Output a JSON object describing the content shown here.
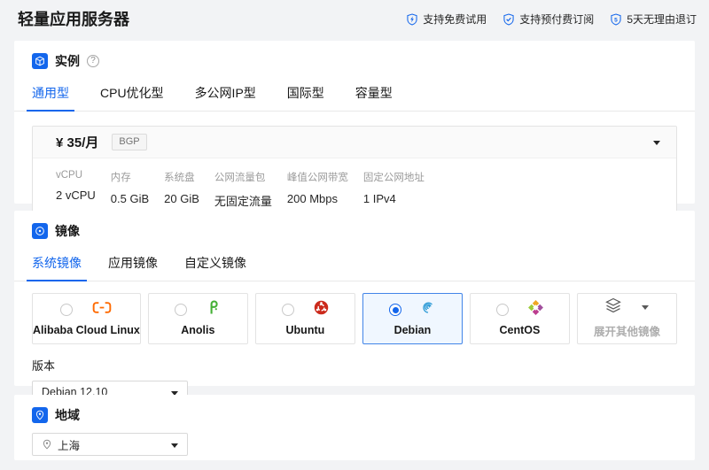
{
  "page": {
    "title": "轻量应用服务器",
    "badges": [
      {
        "label": "支持免费试用"
      },
      {
        "label": "支持预付费订阅"
      },
      {
        "label": "5天无理由退订",
        "glyph": "5"
      }
    ]
  },
  "icons": {
    "help_glyph": "?"
  },
  "colors": {
    "accent": "#1366ec",
    "page_bg": "#f2f3f5",
    "selected_card_bg": "#f0f7ff"
  },
  "instance": {
    "section_title": "实例",
    "tabs": [
      {
        "label": "通用型",
        "active": true
      },
      {
        "label": "CPU优化型",
        "active": false
      },
      {
        "label": "多公网IP型",
        "active": false
      },
      {
        "label": "国际型",
        "active": false
      },
      {
        "label": "容量型",
        "active": false
      }
    ],
    "plan": {
      "price": "¥ 35/月",
      "tag": "BGP",
      "specs": [
        {
          "label": "vCPU",
          "value": "2 vCPU"
        },
        {
          "label": "内存",
          "value": "0.5 GiB"
        },
        {
          "label": "系统盘",
          "value": "20 GiB"
        },
        {
          "label": "公网流量包",
          "value": "无固定流量"
        },
        {
          "label": "峰值公网带宽",
          "value": "200 Mbps"
        },
        {
          "label": "固定公网地址",
          "value": "1 IPv4"
        }
      ]
    }
  },
  "image": {
    "section_title": "镜像",
    "tabs": [
      {
        "label": "系统镜像",
        "active": true
      },
      {
        "label": "应用镜像",
        "active": false
      },
      {
        "label": "自定义镜像",
        "active": false
      }
    ],
    "os_options": [
      {
        "label": "Alibaba Cloud Linux",
        "selected": false
      },
      {
        "label": "Anolis",
        "selected": false
      },
      {
        "label": "Ubuntu",
        "selected": false
      },
      {
        "label": "Debian",
        "selected": true
      },
      {
        "label": "CentOS",
        "selected": false
      }
    ],
    "expand_label": "展开其他镜像",
    "version_label": "版本",
    "version_value": "Debian 12.10"
  },
  "region": {
    "section_title": "地域",
    "value": "上海"
  }
}
